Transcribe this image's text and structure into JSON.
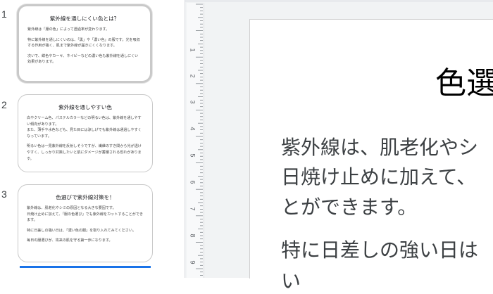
{
  "filmstrip": {
    "slides": [
      {
        "number": "1",
        "title": "紫外線を通しにくい色とは？",
        "paragraphs": [
          "紫外線は「服の色」によって透過率が変わります。",
          "特に紫外線を通しにくいのは、「黒」や「濃い色」の服です。光を吸収する作用が強く、肌まで紫外線が届きにくくなります。",
          "次いで、紺色やカーキ、ネイビーなどの濃い色も紫外線を通しにくい効果があります。"
        ]
      },
      {
        "number": "2",
        "title": "紫外線を通しやすい色",
        "paragraphs": [
          "白やクリーム色、パステルカラーなどの明るい色は、紫外線を通しやすい傾向があります。\nまた、薄手や水色なども、見た目には涼しげでも紫外線は通過しやすくなっています。",
          "明るい色は一見紫外線を反射しそうですが、繊維のすき間から光が透けやすく、しっかり対策したいと肌にダメージが蓄積される恐れがあります。"
        ]
      },
      {
        "number": "3",
        "title": "色選びで紫外線対策を！",
        "paragraphs": [
          "紫外線は、肌老化やシミの原因となる大きな要因です。\n日焼け止めに加えて、「服の色選び」でも紫外線をカットすることができます。",
          "特に日差しの強い日は、「濃い色の服」を取り入れてみてください。",
          "毎日の服選びが、将来の肌を守る第一歩になります。"
        ]
      }
    ]
  },
  "ruler": {
    "numbers": [
      "1",
      "2",
      "3",
      "4",
      "5",
      "6",
      "7",
      "8",
      "9"
    ]
  },
  "canvas": {
    "title": "色選",
    "lines": [
      "紫外線は、肌老化やシ",
      "日焼け止めに加えて、",
      "とができます。",
      "特に日差しの強い日は",
      "い"
    ]
  },
  "colors": {
    "accent": "#1a73e8",
    "editor_bg": "#f1f3f4"
  }
}
